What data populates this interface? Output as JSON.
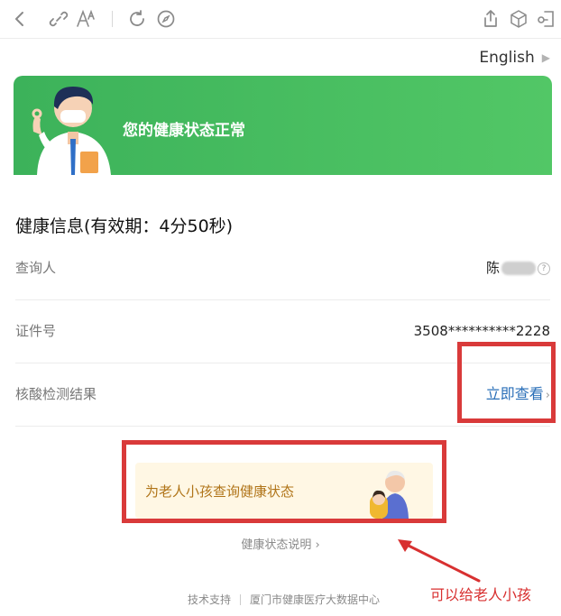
{
  "toolbar": {
    "icons": [
      "back-icon",
      "link-icon",
      "font-size-icon",
      "refresh-icon",
      "compass-icon",
      "share-icon",
      "cube-icon",
      "exit-icon"
    ]
  },
  "header": {
    "language": "English"
  },
  "banner": {
    "status": "您的健康状态正常"
  },
  "info": {
    "title": "健康信息(有效期：4分50秒)",
    "rows": [
      {
        "label": "查询人",
        "value": "陈"
      },
      {
        "label": "证件号",
        "value": "3508**********2228"
      },
      {
        "label": "核酸检测结果",
        "value": "立即查看"
      }
    ]
  },
  "elder": {
    "text": "为老人小孩查询健康状态"
  },
  "explain": {
    "text": "健康状态说明 ›"
  },
  "footer": {
    "support": "技术支持",
    "org": "厦门市健康医疗大数据中心"
  },
  "annotation": {
    "text": "可以给老人小孩",
    "color": "#d83030"
  },
  "colors": {
    "banner_green": "#4cc264",
    "link_blue": "#2a6fb8",
    "highlight_red": "#d93a3a"
  }
}
